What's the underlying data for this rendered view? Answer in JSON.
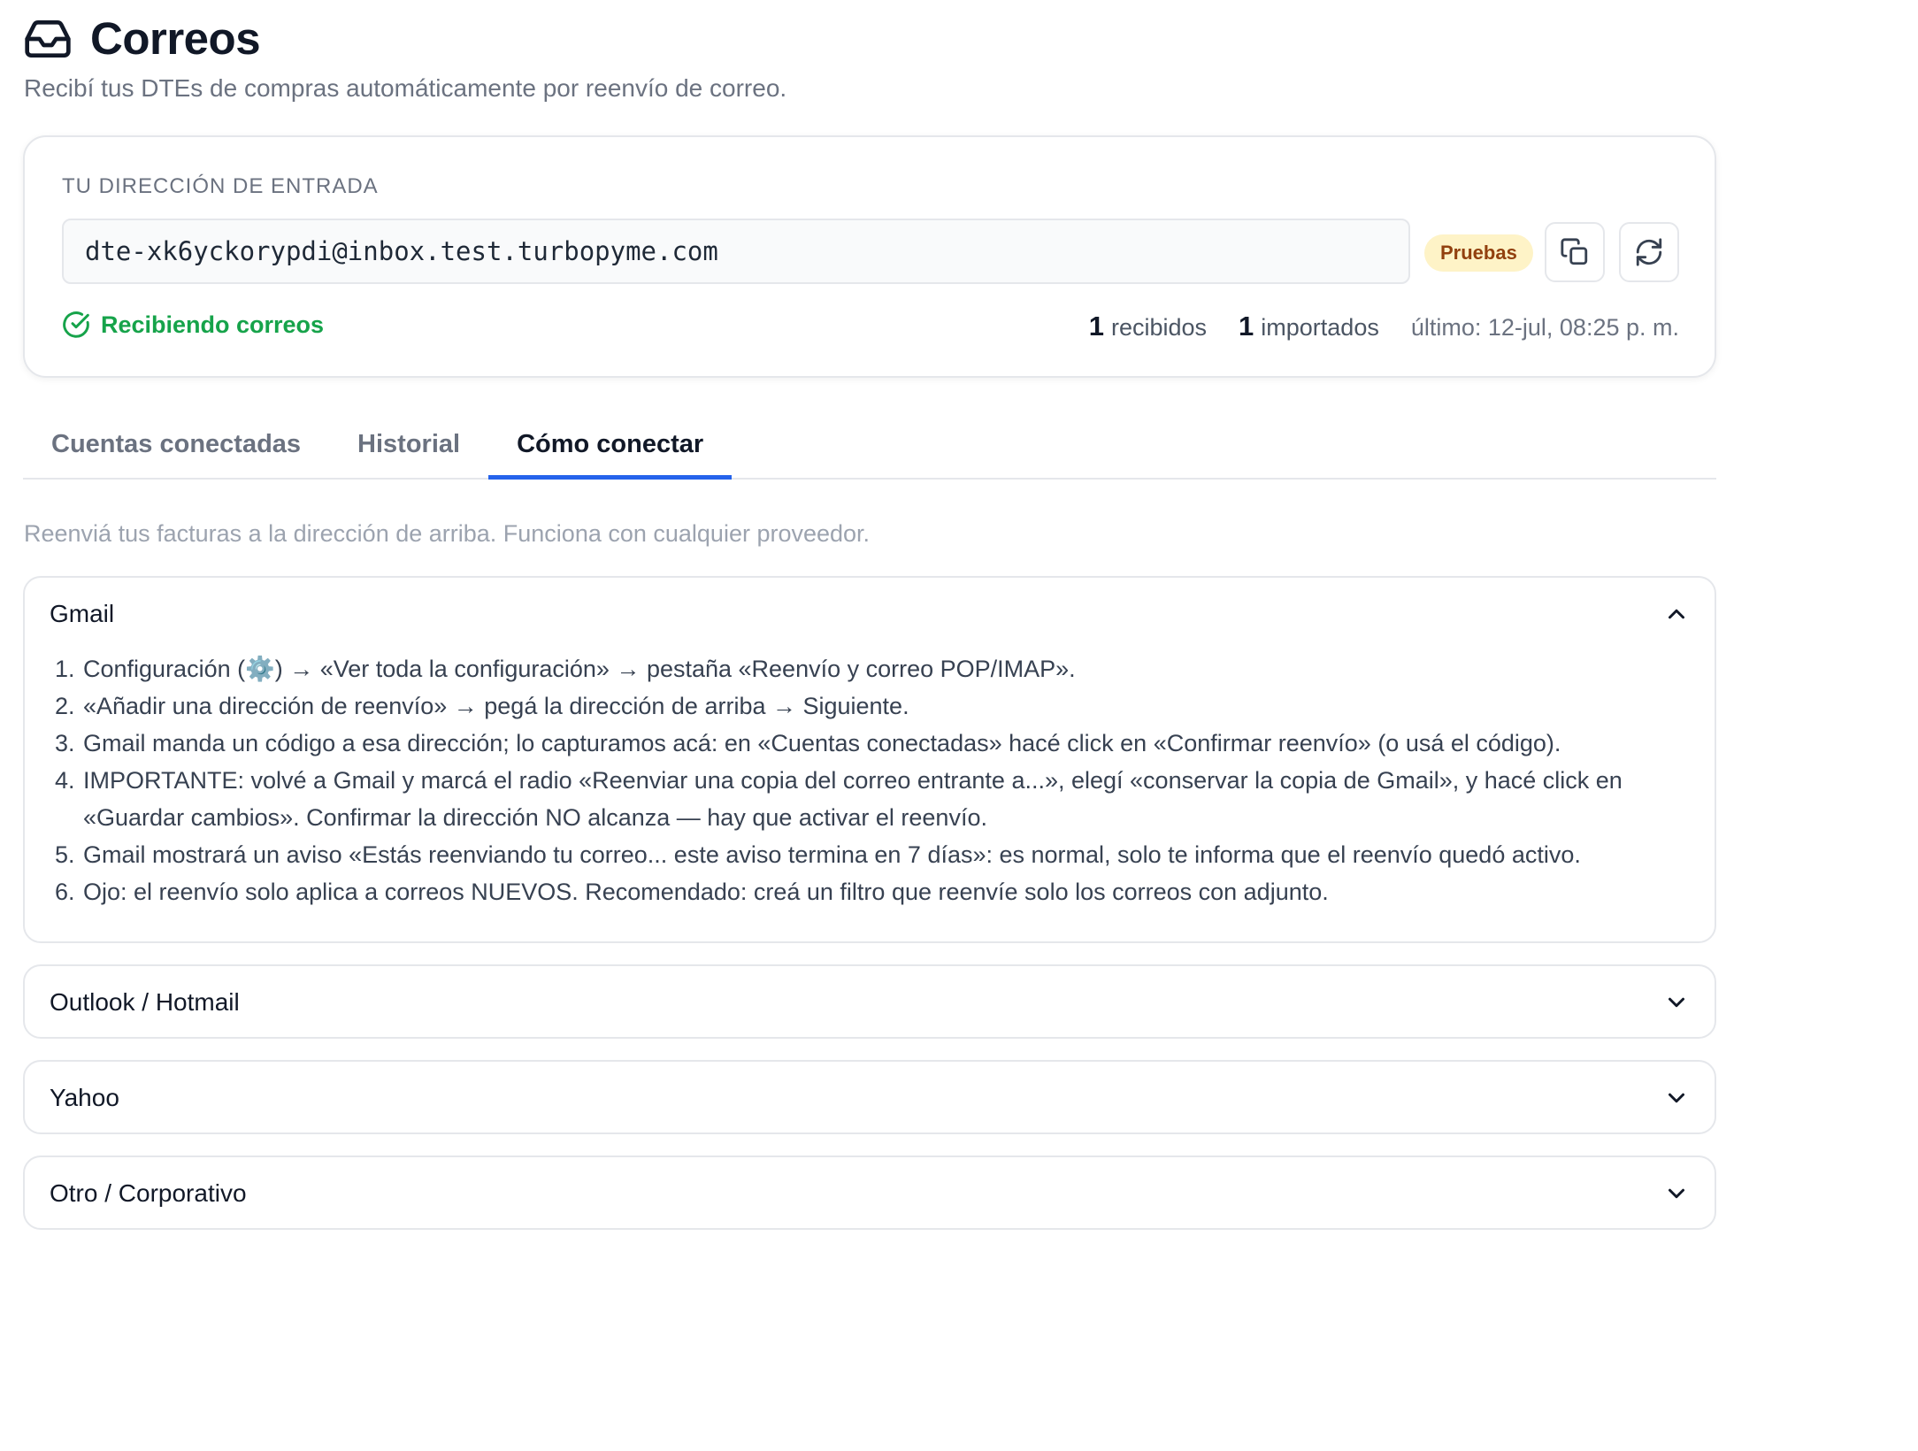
{
  "header": {
    "title": "Correos",
    "subtitle": "Recibí tus DTEs de compras automáticamente por reenvío de correo."
  },
  "inbox": {
    "label": "TU DIRECCIÓN DE ENTRADA",
    "address": "dte-xk6yckorypdi@inbox.test.turbopyme.com",
    "badge": "Pruebas",
    "status": "Recibiendo correos",
    "received_count": "1",
    "received_label": "recibidos",
    "imported_count": "1",
    "imported_label": "importados",
    "last": "último: 12-jul, 08:25 p. m."
  },
  "tabs": [
    {
      "label": "Cuentas conectadas"
    },
    {
      "label": "Historial"
    },
    {
      "label": "Cómo conectar"
    }
  ],
  "helper_text": "Reenviá tus facturas a la dirección de arriba. Funciona con cualquier proveedor.",
  "accordions": {
    "gmail": {
      "title": "Gmail",
      "steps": [
        {
          "num": "1.",
          "text": "Configuración (⚙️) → «Ver toda la configuración» → pestaña «Reenvío y correo POP/IMAP»."
        },
        {
          "num": "2.",
          "text": "«Añadir una dirección de reenvío» → pegá la dirección de arriba → Siguiente."
        },
        {
          "num": "3.",
          "text": "Gmail manda un código a esa dirección; lo capturamos acá: en «Cuentas conectadas» hacé click en «Confirmar reenvío» (o usá el código)."
        },
        {
          "num": "4.",
          "text": "IMPORTANTE: volvé a Gmail y marcá el radio «Reenviar una copia del correo entrante a...», elegí «conservar la copia de Gmail», y hacé click en «Guardar cambios». Confirmar la dirección NO alcanza — hay que activar el reenvío."
        },
        {
          "num": "5.",
          "text": "Gmail mostrará un aviso «Estás reenviando tu correo... este aviso termina en 7 días»: es normal, solo te informa que el reenvío quedó activo."
        },
        {
          "num": "6.",
          "text": "Ojo: el reenvío solo aplica a correos NUEVOS. Recomendado: creá un filtro que reenvíe solo los correos con adjunto."
        }
      ]
    },
    "outlook": {
      "title": "Outlook / Hotmail"
    },
    "yahoo": {
      "title": "Yahoo"
    },
    "otro": {
      "title": "Otro / Corporativo"
    }
  },
  "icons": {
    "header": "inbox-icon",
    "copy": "copy-icon",
    "refresh": "refresh-icon",
    "status": "check-circle-icon",
    "expanded": "chevron-up-icon",
    "collapsed": "chevron-down-icon"
  },
  "colors": {
    "accent": "#2563eb",
    "success": "#16a34a",
    "badge_bg": "#fef3c7",
    "badge_text": "#92400e"
  }
}
